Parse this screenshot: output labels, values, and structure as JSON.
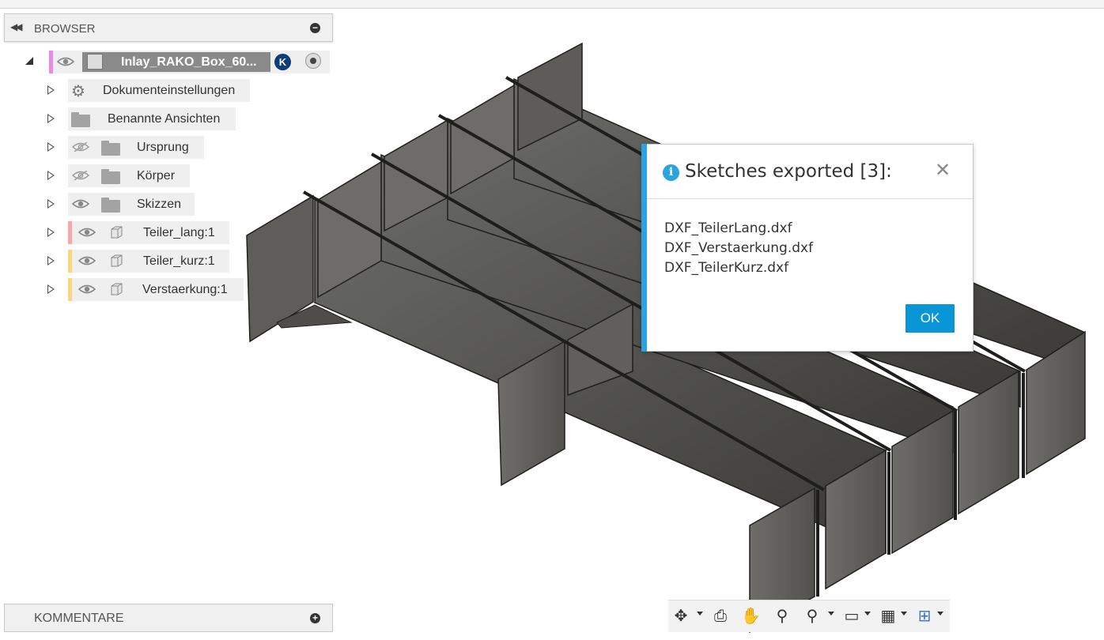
{
  "browser": {
    "title": "BROWSER",
    "root": {
      "name": "Inlay_RAKO_Box_60...",
      "badge": "K"
    },
    "items": [
      {
        "label": "Dokumenteinstellungen"
      },
      {
        "label": "Benannte Ansichten"
      },
      {
        "label": "Ursprung",
        "visibility": "hidden"
      },
      {
        "label": "Körper",
        "visibility": "hidden"
      },
      {
        "label": "Skizzen",
        "visibility": "visible"
      },
      {
        "label": "Teiler_lang:1",
        "color": "#f7a8ab"
      },
      {
        "label": "Teiler_kurz:1",
        "color": "#fbd77a"
      },
      {
        "label": "Verstaerkung:1",
        "color": "#fbd77a"
      }
    ]
  },
  "comments": {
    "title": "KOMMENTARE"
  },
  "dialog": {
    "title": "Sketches exported [3]:",
    "files": [
      "DXF_TeilerLang.dxf",
      "DXF_Verstaerkung.dxf",
      "DXF_TeilerKurz.dxf"
    ],
    "ok_label": "OK",
    "accent_color": "#2aa3e0"
  },
  "navbar": {
    "icons": [
      "orbit-icon",
      "look-at-icon",
      "pan-icon",
      "zoom-icon",
      "fit-icon",
      "display-settings-icon",
      "grid-icon",
      "viewports-icon"
    ]
  }
}
